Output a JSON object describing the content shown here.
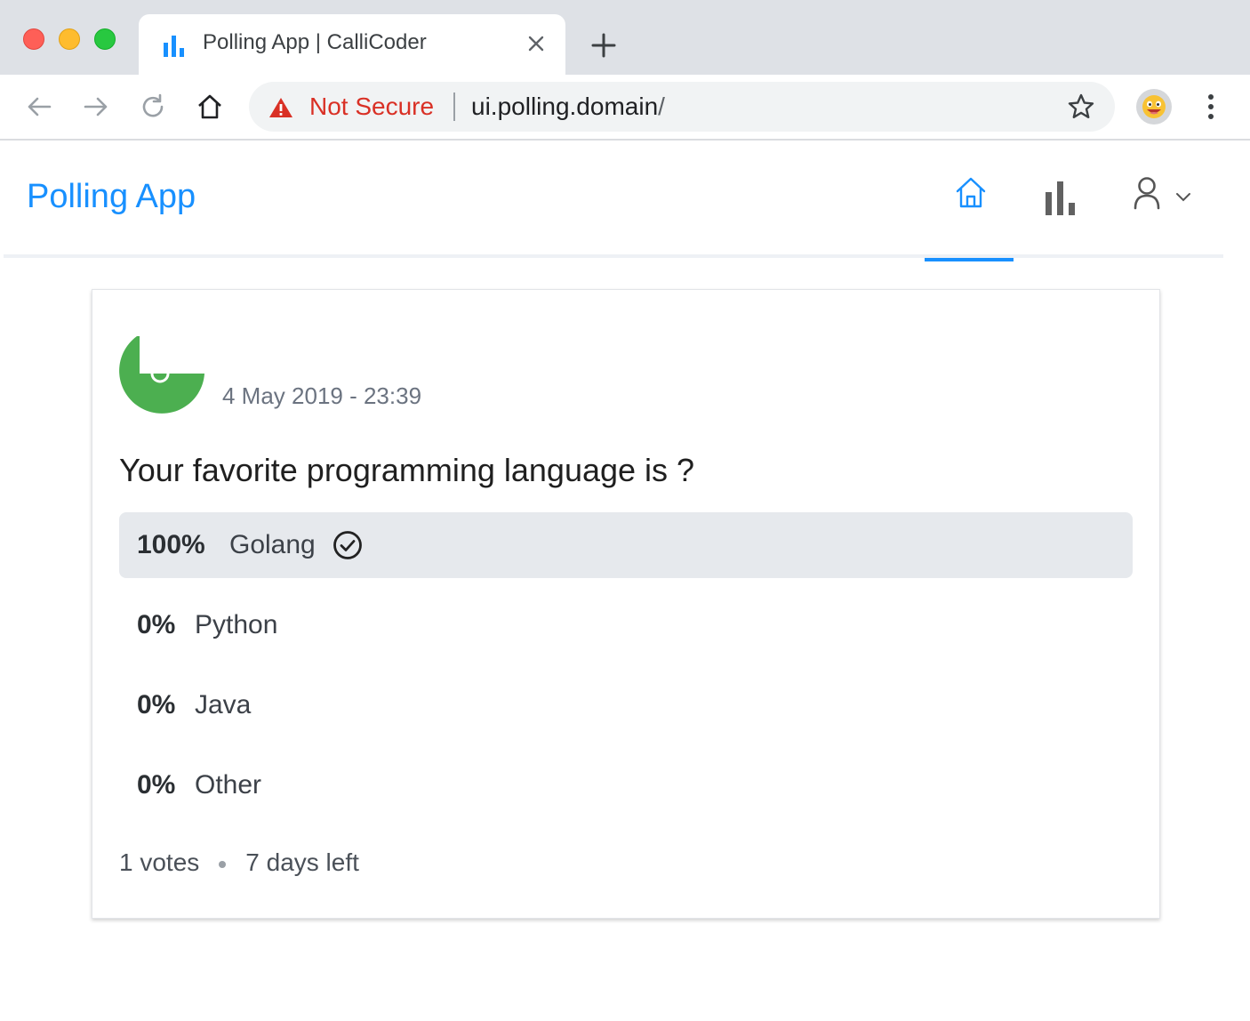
{
  "browser": {
    "tab_title": "Polling App | CalliCoder",
    "security_label": "Not Secure",
    "url_host": "ui.polling.domain",
    "url_path": "/"
  },
  "app": {
    "title": "Polling App",
    "nav": [
      {
        "icon": "home-icon",
        "active": true
      },
      {
        "icon": "bar-chart-icon",
        "active": false
      },
      {
        "icon": "user-icon",
        "active": false
      }
    ],
    "accent_color": "#1890ff"
  },
  "poll": {
    "created": "4 May 2019 - 23:39",
    "question": "Your favorite programming language is ?",
    "choices": [
      {
        "percent": "100%",
        "label": "Golang",
        "selected": true
      },
      {
        "percent": "0%",
        "label": "Python",
        "selected": false
      },
      {
        "percent": "0%",
        "label": "Java",
        "selected": false
      },
      {
        "percent": "0%",
        "label": "Other",
        "selected": false
      }
    ],
    "votes_text": "1 votes",
    "time_left_text": "7 days left",
    "avatar_color": "#4caf50"
  }
}
